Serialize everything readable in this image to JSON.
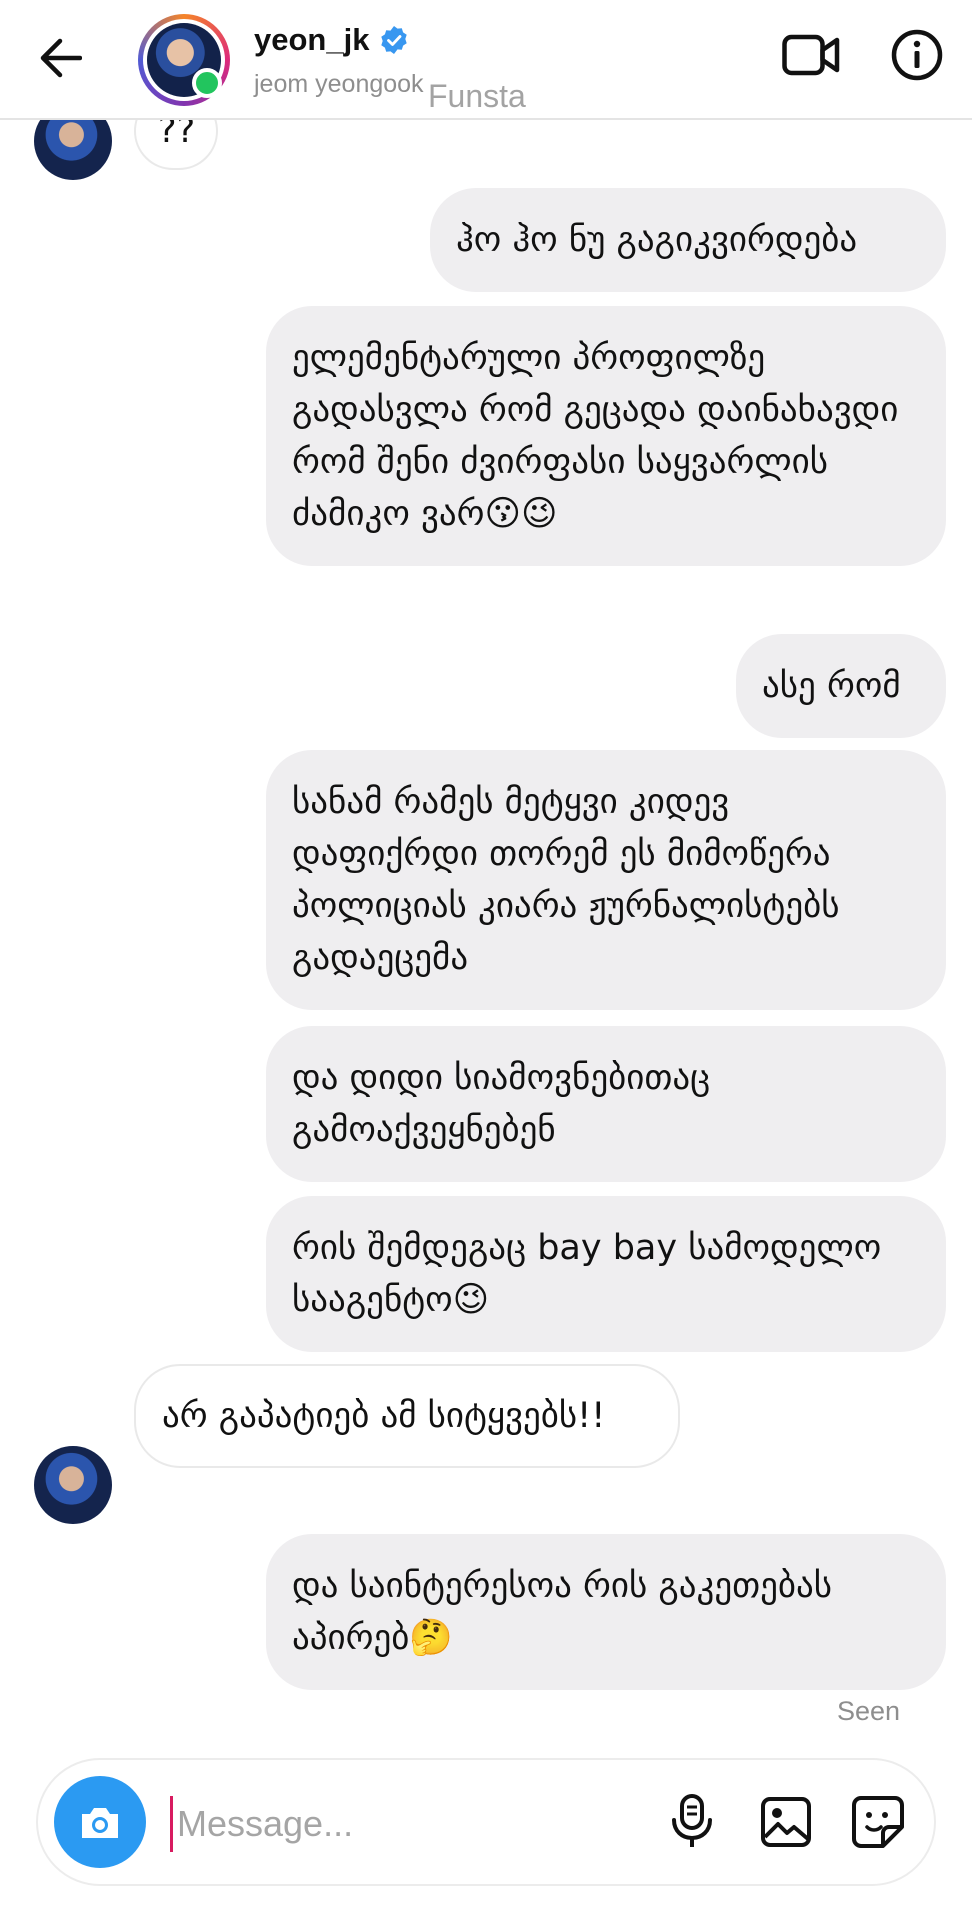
{
  "header": {
    "username": "yeon_jk",
    "subname": "jeom yeongook",
    "watermark": "Funsta"
  },
  "messages": [
    {
      "side": "in",
      "text": "??"
    },
    {
      "side": "out",
      "text": "ჰო ჰო ნუ გაგიკვირდება"
    },
    {
      "side": "out",
      "text": "ელემენტარული პროფილზე გადასვლა რომ გეცადა დაინახავდი რომ შენი ძვირფასი საყვარლის ძამიკო ვარ😗😉"
    },
    {
      "side": "out",
      "text": "ასე რომ"
    },
    {
      "side": "out",
      "text": "სანამ რამეს მეტყვი კიდევ დაფიქრდი თორემ ეს მიმოწერა პოლიციას კიარა ჟურნალისტებს გადაეცემა"
    },
    {
      "side": "out",
      "text": "და დიდი სიამოვნებითაც გამოაქვეყნებენ"
    },
    {
      "side": "out",
      "text": "რის შემდეგაც bay bay სამოდელო სააგენტო😉"
    },
    {
      "side": "in",
      "text": "არ გაპატიებ ამ სიტყვებს!!"
    },
    {
      "side": "out",
      "text": "და საინტერესოა რის გაკეთებას აპირებ🤔"
    }
  ],
  "seen_label": "Seen",
  "composer": {
    "placeholder": "Message..."
  },
  "colors": {
    "accent_blue": "#2b9af2",
    "outgoing_bubble": "#efeef0",
    "online": "#22c55e",
    "verified": "#3897f0"
  }
}
